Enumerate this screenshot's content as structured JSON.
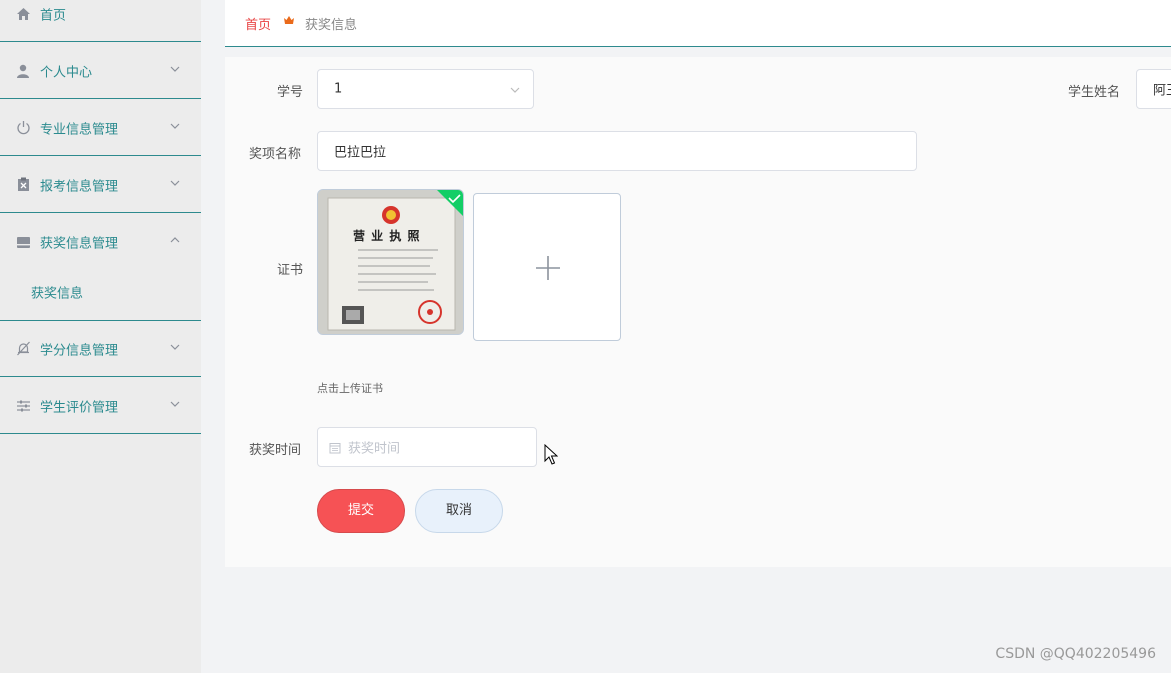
{
  "sidebar": {
    "items": [
      {
        "label": "首页",
        "icon": "home-icon"
      },
      {
        "label": "个人中心",
        "icon": "user-icon"
      },
      {
        "label": "专业信息管理",
        "icon": "power-icon"
      },
      {
        "label": "报考信息管理",
        "icon": "clipboard-icon"
      },
      {
        "label": "获奖信息管理",
        "icon": "inbox-icon"
      },
      {
        "label": "学分信息管理",
        "icon": "bell-off-icon"
      },
      {
        "label": "学生评价管理",
        "icon": "sliders-icon"
      }
    ],
    "subitem": "获奖信息",
    "accent": "#2a8a8e"
  },
  "breadcrumb": {
    "home": "首页",
    "current": "获奖信息"
  },
  "form": {
    "student_id_label": "学号",
    "student_id_value": "1",
    "student_name_label": "学生姓名",
    "student_name_value": "阿王",
    "award_name_label": "奖项名称",
    "award_name_value": "巴拉巴拉",
    "certificate_label": "证书",
    "certificate_title": "营 业 执 照",
    "upload_hint": "点击上传证书",
    "award_time_label": "获奖时间",
    "award_time_placeholder": "获奖时间",
    "submit_label": "提交",
    "cancel_label": "取消"
  },
  "watermark": "CSDN @QQ402205496",
  "colors": {
    "accent": "#2a8a8e",
    "submit": "#f65255",
    "cancel_bg": "#e8f1fb",
    "success": "#13ce66"
  }
}
